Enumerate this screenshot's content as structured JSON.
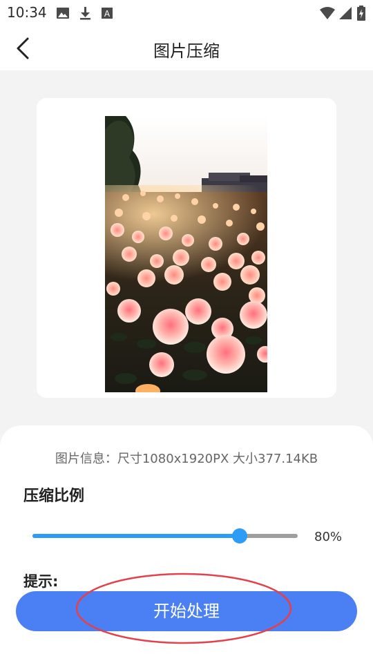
{
  "status_bar": {
    "time": "10:34",
    "icons": [
      "image-icon",
      "download-icon",
      "font-a-icon",
      "wifi-icon",
      "signal-icon",
      "battery-charging-icon"
    ]
  },
  "app_bar": {
    "title": "图片压缩",
    "back_icon": "chevron-left-icon"
  },
  "image_preview": {
    "description_icon": "rose-garden-photo"
  },
  "panel": {
    "info_text": "图片信息：尺寸1080x1920PX 大小377.14KB",
    "section_title": "压缩比例",
    "slider": {
      "value_fraction": 0.78,
      "value_label": "80%"
    },
    "hint_label": "提示:",
    "start_button_label": "开始处理"
  },
  "colors": {
    "accent": "#2d9cf6",
    "button": "#4a80f3",
    "annotation": "#e5404a",
    "background": "#f3f3f3"
  }
}
